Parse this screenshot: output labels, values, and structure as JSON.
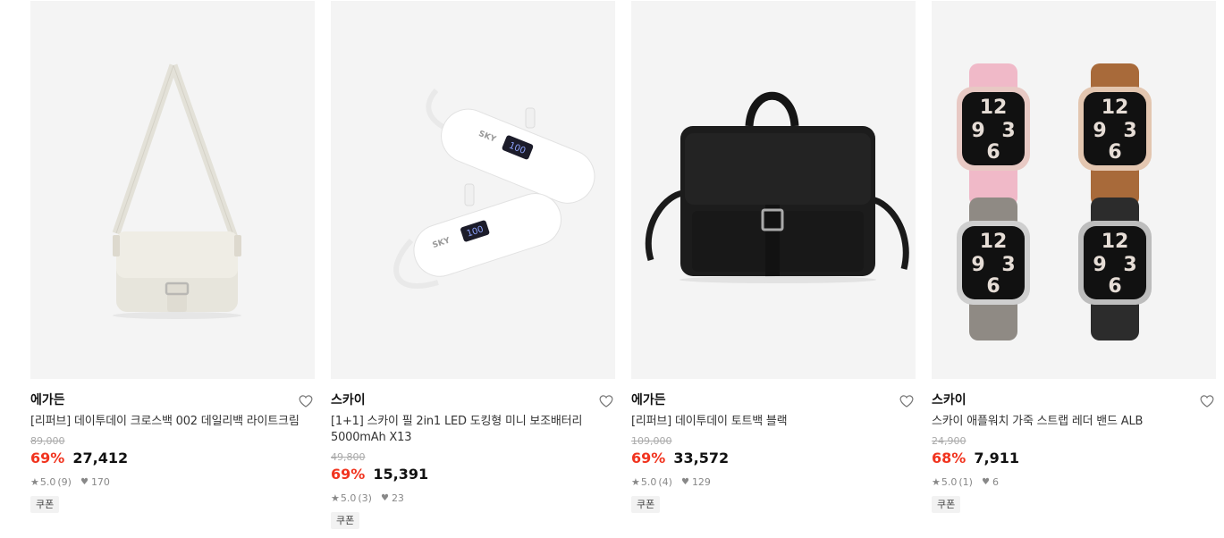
{
  "products": [
    {
      "brand": "에가든",
      "title": "[리퍼브] 데이투데이 크로스백 002 데일리백 라이트크림",
      "original_price": "89,000",
      "discount": "69%",
      "price": "27,412",
      "rating": "5.0",
      "review_count": "(9)",
      "likes": "170",
      "coupon": "쿠폰",
      "image": "cream-crossbody-bag"
    },
    {
      "brand": "스카이",
      "title": "[1+1] 스카이 필 2in1 LED 도킹형 미니 보조배터리 5000mAh X13",
      "original_price": "49,800",
      "discount": "69%",
      "price": "15,391",
      "rating": "5.0",
      "review_count": "(3)",
      "likes": "23",
      "coupon": "쿠폰",
      "image": "white-power-banks",
      "image_text": {
        "logo": "SKY",
        "display": "100"
      }
    },
    {
      "brand": "에가든",
      "title": "[리퍼브] 데이투데이 토트백 블랙",
      "original_price": "109,000",
      "discount": "69%",
      "price": "33,572",
      "rating": "5.0",
      "review_count": "(4)",
      "likes": "129",
      "coupon": "쿠폰",
      "image": "black-tote-bag"
    },
    {
      "brand": "스카이",
      "title": "스카이 애플워치 가죽 스트랩 레더 밴드 ALB",
      "original_price": "24,900",
      "discount": "68%",
      "price": "7,911",
      "rating": "5.0",
      "review_count": "(1)",
      "likes": "6",
      "coupon": "쿠폰",
      "image": "apple-watch-leather-straps",
      "image_text": {
        "dial_top": "12",
        "dial_mid": "9",
        "dial_right": "3",
        "dial_bottom": "6"
      }
    }
  ],
  "colors": {
    "discount": "#f1341f",
    "thumb_bg": "#f4f4f4",
    "muted": "#888888"
  }
}
